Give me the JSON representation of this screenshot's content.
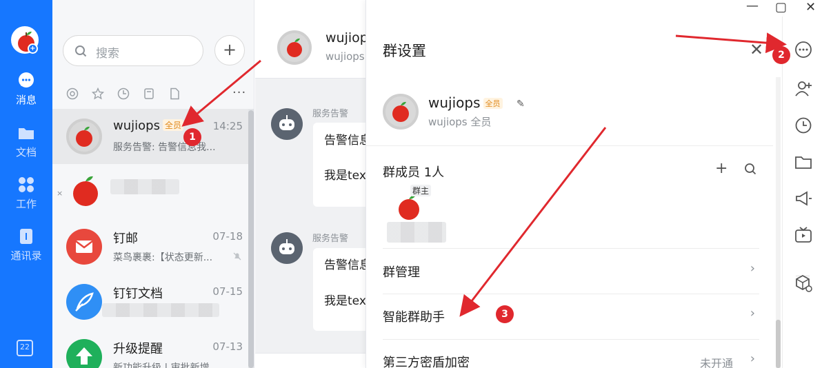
{
  "nav": {
    "items": [
      {
        "label": "消息",
        "icon": "chat-bubble-icon",
        "active": true
      },
      {
        "label": "文档",
        "icon": "folder-icon",
        "active": false
      },
      {
        "label": "工作",
        "icon": "apps-grid-icon",
        "active": false
      },
      {
        "label": "通讯录",
        "icon": "contacts-icon",
        "active": false
      }
    ],
    "calendar_day": "22"
  },
  "search": {
    "placeholder": "搜索"
  },
  "conversations": [
    {
      "name": "wujiops",
      "tag": "全员",
      "time": "14:25",
      "preview": "服务告警: 告警信息我..."
    },
    {
      "name": "",
      "tag": "",
      "time": "",
      "preview": ""
    },
    {
      "name": "钉邮",
      "tag": "",
      "time": "07-18",
      "preview": "菜鸟裹裹:【状态更新..."
    },
    {
      "name": "钉钉文档",
      "tag": "",
      "time": "07-15",
      "preview": ""
    },
    {
      "name": "升级提醒",
      "tag": "",
      "time": "07-13",
      "preview": "新功能升级 | 审批新增..."
    }
  ],
  "chat": {
    "title": "wujiop",
    "subtitle": "wujiops",
    "messages": [
      {
        "sender": "服务告警",
        "line1": "告警信息",
        "line2": "我是tex"
      },
      {
        "sender": "服务告警",
        "line1": "告警信息",
        "line2": "我是tex"
      }
    ]
  },
  "panel": {
    "title": "群设置",
    "group_name": "wujiops",
    "group_tag": "全员",
    "group_sub": "wujiops 全员",
    "members_title": "群成员 1人",
    "owner_label": "群主",
    "rows": [
      {
        "label": "群管理",
        "status": ""
      },
      {
        "label": "智能群助手",
        "status": ""
      },
      {
        "label": "第三方密盾加密",
        "status": "未开通"
      }
    ]
  },
  "annotations": [
    "1",
    "2",
    "3"
  ],
  "colors": {
    "brand": "#1677ff",
    "annotation": "#e0282e",
    "tag": "#e08a1e"
  }
}
